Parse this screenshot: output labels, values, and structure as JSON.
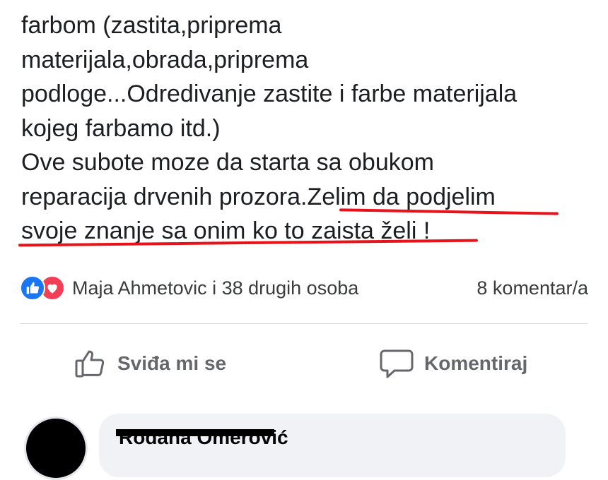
{
  "post": {
    "lines": [
      "farbom (zastita,priprema",
      "materijala,obrada,priprema",
      "podloge...Odredivanje zastite i farbe materijala",
      "kojeg farbamo itd.)",
      "Ove subote moze da starta sa obukom",
      "reparacija drvenih prozora.",
      "Zelim da podjelim",
      "svoje znanje sa onim ko to zaista želi !"
    ]
  },
  "reactions": {
    "icons": [
      "like-icon",
      "love-icon"
    ],
    "summary": "Maja Ahmetovic i 38 drugih osoba",
    "comments_count": "8 komentar/a"
  },
  "actions": {
    "like_label": "Sviđa mi se",
    "comment_label": "Komentiraj"
  },
  "comment": {
    "author_name": "Rodana Omerović"
  },
  "colors": {
    "accent_like": "#1877f2",
    "accent_love": "#f33e58",
    "annotation_red": "#e8131a",
    "text_primary": "#1c1e21",
    "text_secondary": "#65676b"
  }
}
